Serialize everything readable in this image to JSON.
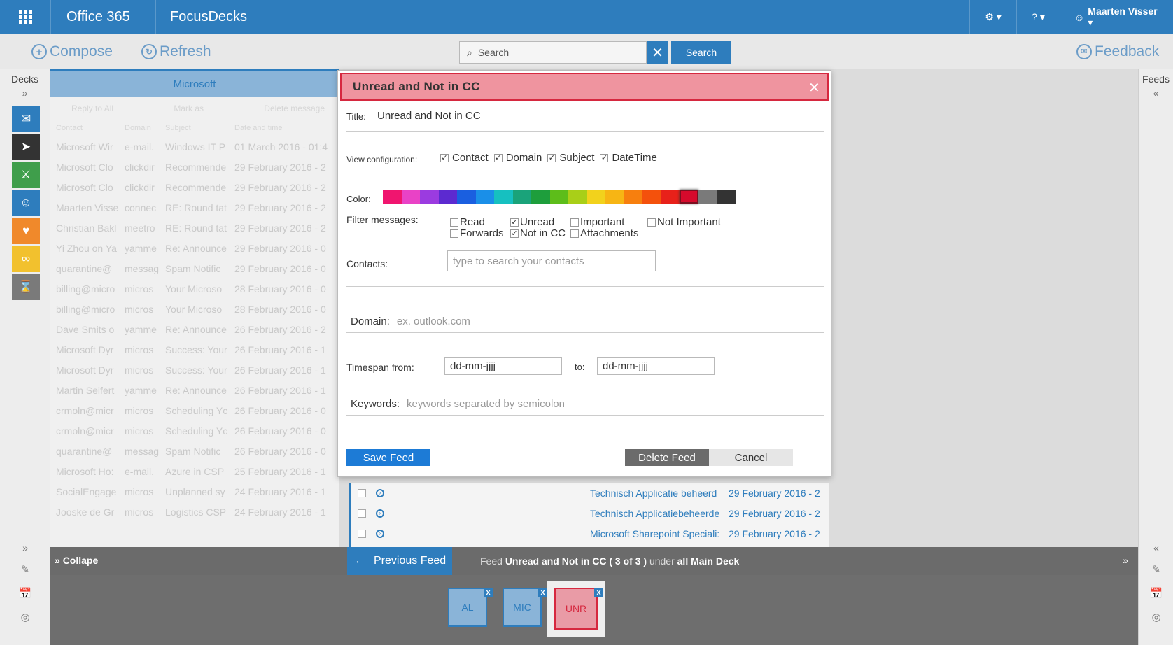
{
  "topbar": {
    "suite": "Office 365",
    "app": "FocusDecks",
    "settings": "⚙ ▾",
    "help": "? ▾",
    "user": "Maarten Visser ▾"
  },
  "toolbar": {
    "compose": "Compose",
    "refresh": "Refresh",
    "search_placeholder": "Search",
    "search_button": "Search",
    "feedback": "Feedback"
  },
  "left_rail": {
    "title": "Decks",
    "chevron": "»",
    "bottom_chevron": "»"
  },
  "right_rail": {
    "title": "Feeds",
    "chevron": "«",
    "bottom_chevron": "«"
  },
  "deck_colors": [
    "#2e7dbd",
    "#333333",
    "#3f9e4b",
    "#2e7dbd",
    "#f0892b",
    "#f2c12e",
    "#7a7a7a"
  ],
  "list": {
    "title": "Microsoft",
    "actions": [
      "Reply to All",
      "Mark as",
      "Delete message"
    ],
    "columns": [
      "Contact",
      "Domain",
      "Subject",
      "Date and time"
    ],
    "rows": [
      [
        "Microsoft Wir",
        "e-mail.",
        "Windows IT P",
        "01 March 2016 - 01:4"
      ],
      [
        "Microsoft Clo",
        "clickdir",
        "Recommende",
        "29 February 2016 - 2"
      ],
      [
        "Microsoft Clo",
        "clickdir",
        "Recommende",
        "29 February 2016 - 2"
      ],
      [
        "Maarten Visse",
        "connec",
        "RE: Round tat",
        "29 February 2016 - 2"
      ],
      [
        "Christian Bakl",
        "meetro",
        "RE: Round tat",
        "29 February 2016 - 2"
      ],
      [
        "Yi Zhou on Ya",
        "yamme",
        "Re: Announce",
        "29 February 2016 - 0"
      ],
      [
        "quarantine@",
        "messag",
        "Spam Notific",
        "29 February 2016 - 0"
      ],
      [
        "billing@micro",
        "micros",
        "Your Microso",
        "28 February 2016 - 0"
      ],
      [
        "billing@micro",
        "micros",
        "Your Microso",
        "28 February 2016 - 0"
      ],
      [
        "Dave Smits o",
        "yamme",
        "Re: Announce",
        "26 February 2016 - 2"
      ],
      [
        "Microsoft Dyr",
        "micros",
        "Success: Your",
        "26 February 2016 - 1"
      ],
      [
        "Microsoft Dyr",
        "micros",
        "Success: Your",
        "26 February 2016 - 1"
      ],
      [
        "Martin Seifert",
        "yamme",
        "Re: Announce",
        "26 February 2016 - 1"
      ],
      [
        "crmoln@micr",
        "micros",
        "Scheduling Yc",
        "26 February 2016 - 0"
      ],
      [
        "crmoln@micr",
        "micros",
        "Scheduling Yc",
        "26 February 2016 - 0"
      ],
      [
        "quarantine@",
        "messag",
        "Spam Notific",
        "26 February 2016 - 0"
      ],
      [
        "Microsoft Ho:",
        "e-mail.",
        "Azure in CSP",
        "25 February 2016 - 1"
      ],
      [
        "SocialEngage",
        "micros",
        "Unplanned sy",
        "24 February 2016 - 1"
      ],
      [
        "Jooske de Gr",
        "micros",
        "Logistics CSP",
        "24 February 2016 - 1"
      ]
    ]
  },
  "sub_list": [
    {
      "from": "Technisch Applicatie beheerd",
      "date": "29 February 2016 - 2"
    },
    {
      "from": "Technisch Applicatiebeheerde",
      "date": "29 February 2016 - 2"
    },
    {
      "from": "Microsoft Sharepoint Speciali:",
      "date": "29 February 2016 - 2"
    }
  ],
  "bottom": {
    "collapse": "Collape",
    "prev_feed": "Previous Feed",
    "feed_prefix": "Feed",
    "feed_name": "Unread and Not in CC ( 3 of 3 )",
    "under": "under",
    "deck_name": "all Main Deck",
    "tabs": [
      "AL",
      "MIC",
      "UNR"
    ]
  },
  "modal": {
    "title": "Unread and Not in CC",
    "title_label": "Title:",
    "title_value": "Unread and Not in CC",
    "view_label": "View configuration:",
    "view_options": [
      "Contact",
      "Domain",
      "Subject",
      "DateTime"
    ],
    "color_label": "Color:",
    "colors": [
      "#f0156f",
      "#e942c6",
      "#9b3be0",
      "#5c2ad0",
      "#1a5fe0",
      "#1a8fe8",
      "#16c0c0",
      "#1aa37a",
      "#1e9e3c",
      "#5dbd1a",
      "#a9cf18",
      "#f2d21c",
      "#f7b514",
      "#f77f0e",
      "#f4510c",
      "#e8211a",
      "#d60a2c",
      "#7a7a7a",
      "#333333"
    ],
    "selected_color": "#d60a2c",
    "filter_label": "Filter messages:",
    "filters": [
      {
        "label": "Read",
        "checked": false
      },
      {
        "label": "Unread",
        "checked": true
      },
      {
        "label": "Important",
        "checked": false
      },
      {
        "label": "Not Important",
        "checked": false
      },
      {
        "label": "Forwards",
        "checked": false
      },
      {
        "label": "Not in CC",
        "checked": true
      },
      {
        "label": "Attachments",
        "checked": false
      }
    ],
    "contacts_label": "Contacts:",
    "contacts_placeholder": "type to search your contacts",
    "domain_label": "Domain:",
    "domain_placeholder": "ex. outlook.com",
    "timespan_label": "Timespan from:",
    "timespan_from": "dd-mm-jjjj",
    "to_label": "to:",
    "timespan_to": "dd-mm-jjjj",
    "keywords_label": "Keywords:",
    "keywords_placeholder": "keywords separated by semicolon",
    "save": "Save Feed",
    "delete": "Delete Feed",
    "cancel": "Cancel",
    "close": "✕"
  }
}
